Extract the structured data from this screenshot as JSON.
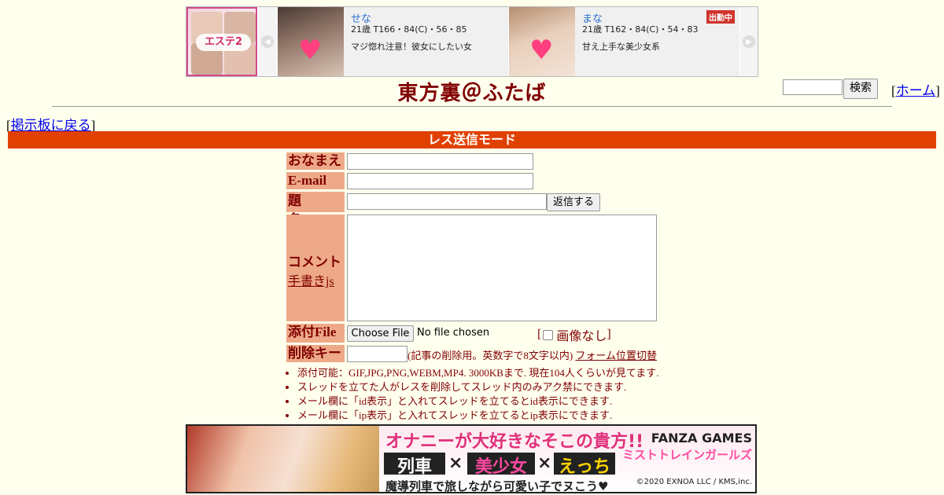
{
  "top_ad": {
    "shop_logo": "エステ2",
    "cards": [
      {
        "name": "せな",
        "spec": "21歳 T166・84(C)・56・85",
        "catch": "マジ惚れ注意！彼女にしたい女",
        "badge": ""
      },
      {
        "name": "まな",
        "spec": "21歳 T162・84(C)・54・83",
        "catch": "甘え上手な美少女系",
        "badge": "出勤中"
      }
    ]
  },
  "header": {
    "title": "東方裏＠ふたば",
    "search_button": "検索",
    "home_link": "ホーム",
    "back_link": "掲示板に戻る"
  },
  "mode_bar": "レス送信モード",
  "form": {
    "name_label": "おなまえ",
    "email_label": "E-mail",
    "subject_label": "題　名",
    "reply_button": "返信する",
    "comment_label": "コメント",
    "handwriting_link": "手書きjs",
    "file_label": "添付File",
    "choose_file_button": "Choose File",
    "no_file_text": "No file chosen",
    "no_image_label": "画像なし",
    "delkey_label": "削除キー",
    "delkey_note": "(記事の削除用。英数字で8文字以内)",
    "form_position_link": "フォーム位置切替"
  },
  "notes": [
    "添付可能：GIF,JPG,PNG,WEBM,MP4. 3000KBまで. 現在104人くらいが見てます.",
    "スレッドを立てた人がレスを削除してスレッド内のみアク禁にできます.",
    "メール欄に「id表示」と入れてスレッドを立てるとid表示にできます.",
    "メール欄に「ip表示」と入れてスレッドを立てるとip表示にできます."
  ],
  "bottom_banner": {
    "headline": "オナニーが大好きなそこの貴方!!",
    "brand": "FANZA GAMES",
    "game_title": "ミストトレインガールズ",
    "keywords": [
      "列車",
      "美少女",
      "えっち"
    ],
    "times_sign": "×",
    "tagline": "魔導列車で旅しながら可愛い子でヌこう♥",
    "copyright": "©2020 EXNOA LLC / KMS,inc."
  },
  "colors": {
    "page_bg": "#ffffee",
    "text": "#800000",
    "mode_bar": "#e04000",
    "label_bg": "#eeaa88",
    "link": "#0000ee"
  }
}
